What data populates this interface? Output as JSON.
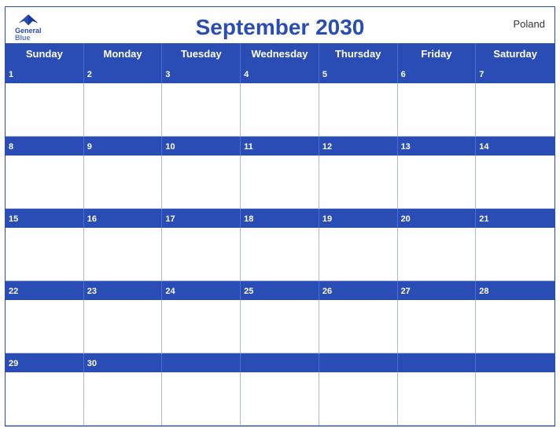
{
  "calendar": {
    "title": "September 2030",
    "country": "Poland",
    "logo": {
      "line1": "General",
      "line2": "Blue"
    },
    "days_of_week": [
      "Sunday",
      "Monday",
      "Tuesday",
      "Wednesday",
      "Thursday",
      "Friday",
      "Saturday"
    ],
    "weeks": [
      {
        "dates": [
          "1",
          "2",
          "3",
          "4",
          "5",
          "6",
          "7"
        ],
        "empties": []
      },
      {
        "dates": [
          "8",
          "9",
          "10",
          "11",
          "12",
          "13",
          "14"
        ],
        "empties": []
      },
      {
        "dates": [
          "15",
          "16",
          "17",
          "18",
          "19",
          "20",
          "21"
        ],
        "empties": []
      },
      {
        "dates": [
          "22",
          "23",
          "24",
          "25",
          "26",
          "27",
          "28"
        ],
        "empties": []
      },
      {
        "dates": [
          "29",
          "30",
          "",
          "",
          "",
          "",
          ""
        ],
        "empties": [
          2,
          3,
          4,
          5,
          6
        ]
      }
    ]
  }
}
